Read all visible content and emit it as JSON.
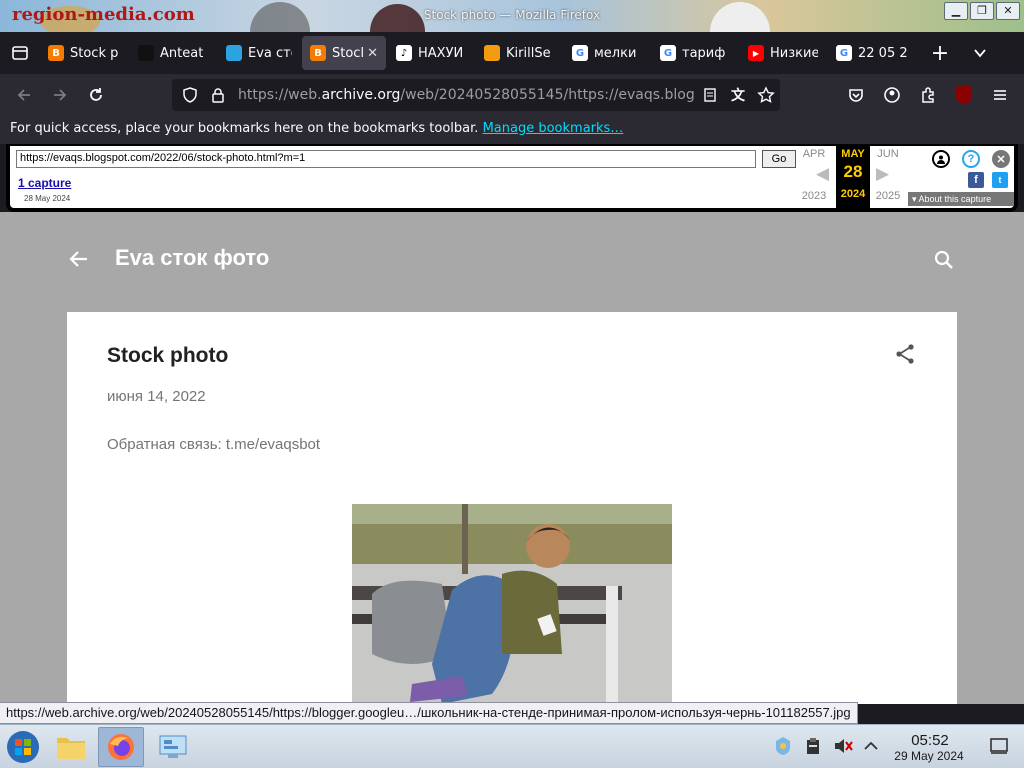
{
  "window": {
    "title": "Stock photo — Mozilla Firefox",
    "wallpaper_text": "region-media.com"
  },
  "tabs": [
    {
      "label": "Stock p",
      "icon": "blogger-icon",
      "color": "#f57c00",
      "active": false
    },
    {
      "label": "Anteat",
      "icon": "anteater-icon",
      "color": "#111111",
      "active": false
    },
    {
      "label": "Eva сто",
      "icon": "telegram-icon",
      "color": "#2aa3e0",
      "active": false
    },
    {
      "label": "Stock",
      "icon": "blogger-icon",
      "color": "#f57c00",
      "active": true
    },
    {
      "label": "НАХУЙ",
      "icon": "tiktok-icon",
      "color": "#ffffff",
      "active": false
    },
    {
      "label": "KirillSe",
      "icon": "fruit-icon",
      "color": "#f39c12",
      "active": false
    },
    {
      "label": "мелки",
      "icon": "google-icon",
      "color": "#ffffff",
      "active": false
    },
    {
      "label": "тариф",
      "icon": "google-icon",
      "color": "#ffffff",
      "active": false
    },
    {
      "label": "Низкие",
      "icon": "youtube-icon",
      "color": "#ff0000",
      "active": false
    },
    {
      "label": "22 05 2",
      "icon": "google-icon",
      "color": "#ffffff",
      "active": false
    }
  ],
  "navbar": {
    "url_prefix": "https://web.",
    "url_host": "archive.org",
    "url_rest": "/web/20240528055145/https://evaqs.blog"
  },
  "bookmarks_bar": {
    "text": "For quick access, place your bookmarks here on the bookmarks toolbar.",
    "link": "Manage bookmarks…"
  },
  "wayback": {
    "url_value": "https://evaqs.blogspot.com/2022/06/stock-photo.html?m=1",
    "go_label": "Go",
    "captures_label": "1 capture",
    "captures_date": "28 May 2024",
    "prev_month": "APR",
    "cur_month": "MAY",
    "next_month": "JUN",
    "cur_day": "28",
    "prev_year": "2023",
    "cur_year": "2024",
    "next_year": "2025",
    "about_label": "About this capture"
  },
  "blog": {
    "title": "Eva сток фото",
    "post_title": "Stock photo",
    "post_date": "июня 14, 2022",
    "post_body": "Обратная связь: t.me/evaqsbot"
  },
  "status_url": "https://web.archive.org/web/20240528055145/https://blogger.googleu…/школьник-на-стенде-принимая-пролом-используя-чернь-101182557.jpg",
  "taskbar": {
    "clock_time": "05:52",
    "clock_date": "29 May 2024"
  }
}
